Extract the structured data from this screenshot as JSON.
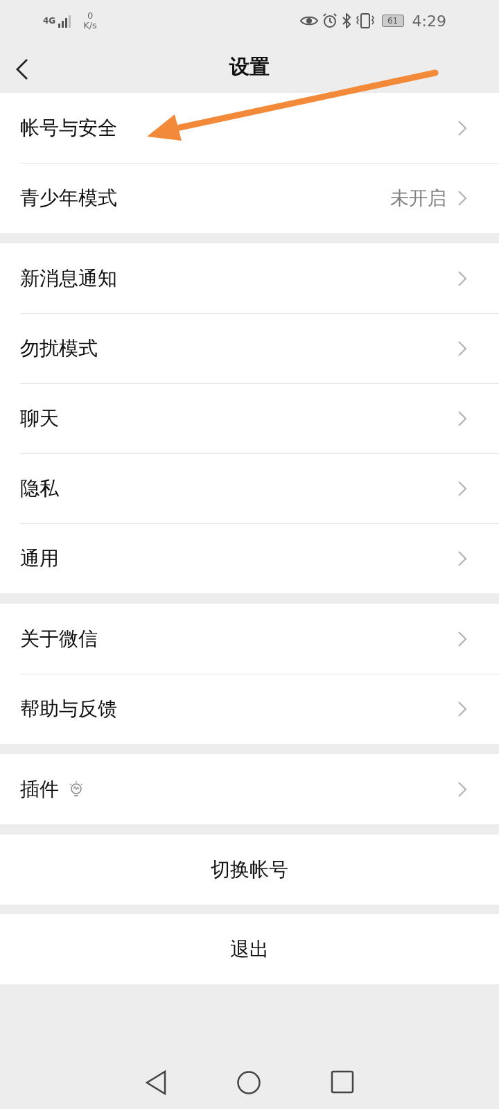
{
  "status_bar": {
    "network": "4G",
    "speed_value": "0",
    "speed_unit": "K/s",
    "battery": "61",
    "time": "4:29"
  },
  "nav": {
    "title": "设置"
  },
  "groups": [
    {
      "rows": [
        {
          "label": "帐号与安全",
          "kind": "plain"
        },
        {
          "label": "青少年模式",
          "value": "未开启",
          "kind": "plain"
        }
      ]
    },
    {
      "rows": [
        {
          "label": "新消息通知",
          "kind": "plain"
        },
        {
          "label": "勿扰模式",
          "kind": "plain"
        },
        {
          "label": "聊天",
          "kind": "plain"
        },
        {
          "label": "隐私",
          "kind": "plain"
        },
        {
          "label": "通用",
          "kind": "plain"
        }
      ]
    },
    {
      "rows": [
        {
          "label": "关于微信",
          "kind": "plain"
        },
        {
          "label": "帮助与反馈",
          "kind": "plain"
        }
      ]
    },
    {
      "rows": [
        {
          "label": "插件",
          "kind": "plugin"
        }
      ]
    }
  ],
  "buttons": [
    "切换帐号",
    "退出"
  ],
  "annotation": {
    "kind": "arrow",
    "color": "#f28a3a"
  }
}
